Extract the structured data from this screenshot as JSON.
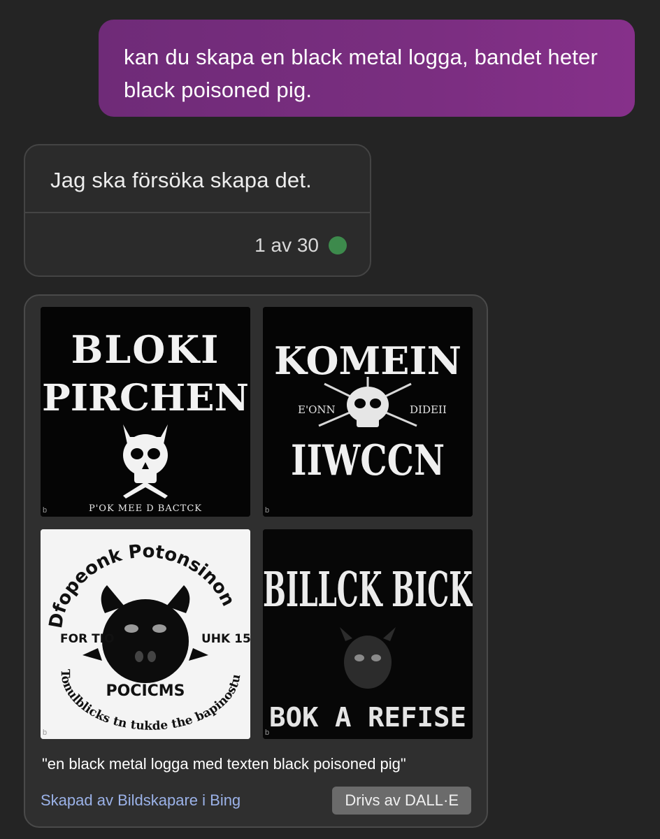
{
  "conversation": {
    "user_message": "kan du skapa en black metal logga, bandet heter black poisoned pig.",
    "bot_message": "Jag ska försöka skapa det.",
    "turn_counter": "1 av 30",
    "status_color": "#3d8a4c"
  },
  "image_result": {
    "prompt": "\"en black metal logga med texten black poisoned pig\"",
    "creator_link": "Skapad av Bildskapare i Bing",
    "powered_by": "Drivs av DALL·E",
    "images": [
      {
        "logo_lines": [
          "BLOKI",
          "PIRCHEN"
        ],
        "caption": "P'OK MEE D BACTCK",
        "mark": "b"
      },
      {
        "logo_lines": [
          "KOMEIN",
          "IIWCCN"
        ],
        "sub_left": "E'ONN",
        "sub_right": "DIDEII",
        "mark": "b"
      },
      {
        "arc_top": "Dfopeonk Potonsinon",
        "left_label": "FOR TIO",
        "right_label": "UHK 15",
        "center_label": "POCICMS",
        "arc_bottom": "Tonulblicks tn tukde the bapinostutm",
        "mark": "b"
      },
      {
        "logo_lines": [
          "BILLCK BICK"
        ],
        "caption": "BOK A REFISE",
        "mark": "b"
      }
    ]
  }
}
